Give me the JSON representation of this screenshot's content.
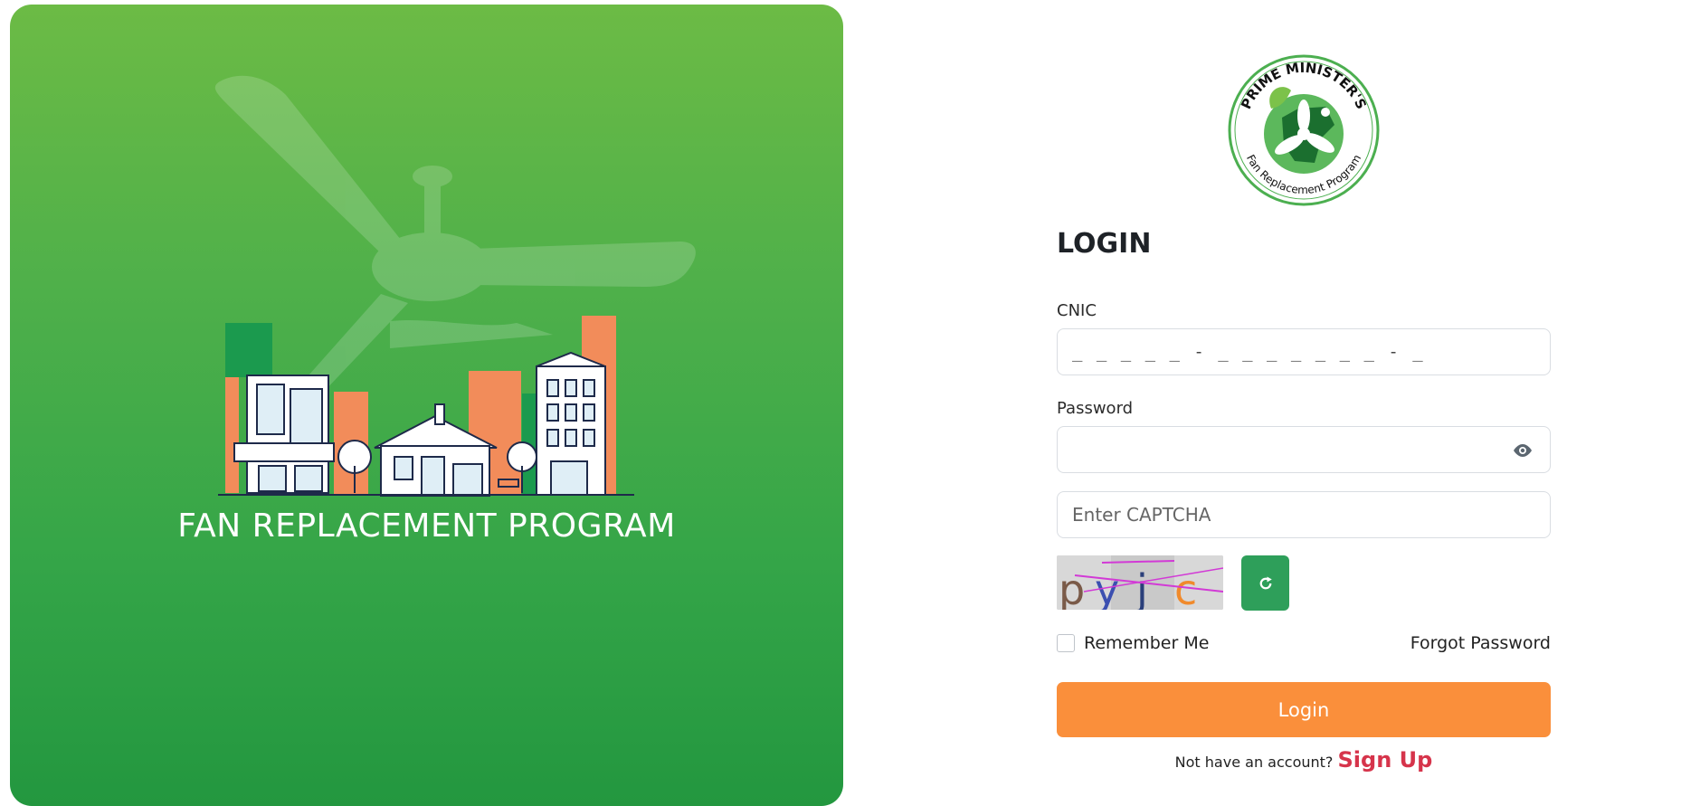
{
  "hero": {
    "title": "FAN REPLACEMENT PROGRAM",
    "gradient_top": "#6cbb45",
    "gradient_bottom": "#23973f"
  },
  "logo": {
    "ring_text_top": "PRIME MINISTER'S",
    "ring_text_bottom": "Fan Replacement Program"
  },
  "form": {
    "heading": "LOGIN",
    "cnic_label": "CNIC",
    "cnic_mask": "_ _ _ _ _ - _ _ _ _ _ _ _ - _",
    "password_label": "Password",
    "password_icon": "eye-icon",
    "captcha_placeholder": "Enter CAPTCHA",
    "captcha_text": "pyjc",
    "refresh_icon": "refresh-icon",
    "remember_label": "Remember Me",
    "forgot_label": "Forgot Password",
    "login_label": "Login",
    "signup_prompt": "Not have an account?",
    "signup_label": "Sign Up"
  },
  "colors": {
    "primary_green": "#2e9f5a",
    "login_orange": "#fa8f3b",
    "signup_red": "#d6344b"
  }
}
